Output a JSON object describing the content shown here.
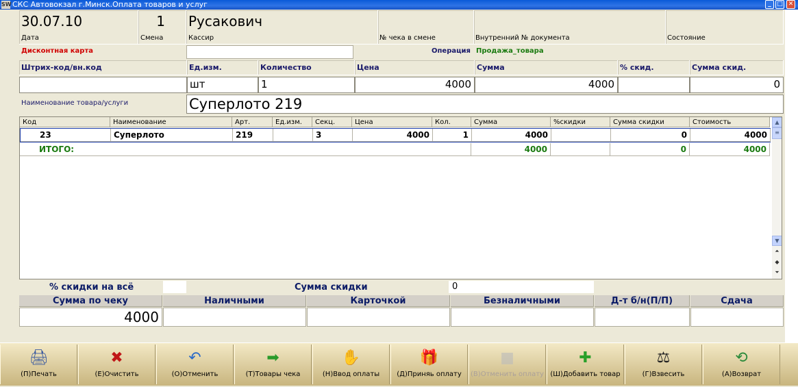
{
  "window": {
    "title": "СКС Автовокзал г.Минск.Оплата товаров и услуг",
    "icon_text": "SW"
  },
  "header": {
    "date_value": "30.07.10",
    "date_label": "Дата",
    "shift_value": "1",
    "shift_label": "Смена",
    "cashier_value": "Русакович",
    "cashier_label": "Кассир",
    "check_no_label": "№ чека в смене",
    "internal_doc_label": "Внутренний № документа",
    "state_label": "Состояние"
  },
  "discount": {
    "label": "Дисконтная карта",
    "value": ""
  },
  "operation": {
    "label": "Операция",
    "value": "Продажа_товара",
    "label_color": "#1a1a6a",
    "value_color": "#1a7a10"
  },
  "entry": {
    "barcode_label": "Штрих-код/вн.код",
    "barcode_value": "",
    "unit_label": "Ед.изм.",
    "unit_value": "шт",
    "qty_label": "Количество",
    "qty_value": "1",
    "price_label": "Цена",
    "price_value": "4000",
    "sum_label": "Сумма",
    "sum_value": "4000",
    "disc_pct_label": "% скид.",
    "disc_pct_value": "",
    "disc_sum_label": "Сумма скид.",
    "disc_sum_value": "0",
    "name_label": "Наименование товара/услуги",
    "name_value": "Суперлото 219"
  },
  "grid": {
    "columns": [
      "Код",
      "Наименование",
      "Арт.",
      "Ед.изм.",
      "Секц.",
      "Цена",
      "Кол.",
      "Сумма",
      "%скидки",
      "Сумма скидки",
      "Стоимость"
    ],
    "rows": [
      [
        "23",
        "Суперлото",
        "219",
        "",
        "3",
        "4000",
        "1",
        "4000",
        "",
        "0",
        "4000"
      ]
    ],
    "total": {
      "label": "ИТОГО:",
      "sum": "4000",
      "disc_sum": "0",
      "cost": "4000"
    }
  },
  "summary": {
    "discount_all_label": "% скидки на всё",
    "discount_all_value": "",
    "discount_sum_label": "Сумма скидки",
    "discount_sum_value": "0",
    "check_sum_label": "Сумма по чеку",
    "check_sum_value": "4000",
    "cash_label": "Наличными",
    "cash_value": "",
    "card_label": "Карточкой",
    "card_value": "",
    "noncash_label": "Безналичными",
    "noncash_value": "",
    "dt_label": "Д-т б/н(П/П)",
    "dt_value": "",
    "change_label": "Сдача",
    "change_value": ""
  },
  "toolbar": [
    {
      "label": "(П)Печать",
      "icon": "printer-icon",
      "glyph": "🖨",
      "enabled": true
    },
    {
      "label": "(Е)Очистить",
      "icon": "clear-doc-icon",
      "glyph": "✖",
      "enabled": true
    },
    {
      "label": "(О)Отменить",
      "icon": "undo-arrow-icon",
      "glyph": "↶",
      "enabled": true
    },
    {
      "label": "(Т)Товары чека",
      "icon": "doc-arrow-icon",
      "glyph": "➡",
      "enabled": true
    },
    {
      "label": "(Н)Ввод оплаты",
      "icon": "payment-hand-icon",
      "glyph": "✋",
      "enabled": true
    },
    {
      "label": "(Д)Приняь оплату",
      "icon": "gift-box-icon",
      "glyph": "🎁",
      "enabled": true
    },
    {
      "label": "(В)Отменить оплату",
      "icon": "cancel-payment-icon",
      "glyph": "■",
      "enabled": false
    },
    {
      "label": "(Ш)Добавить товар",
      "icon": "add-item-icon",
      "glyph": "✚",
      "enabled": true
    },
    {
      "label": "(Г)Взвесить",
      "icon": "weight-icon",
      "glyph": "⚖",
      "enabled": true
    },
    {
      "label": "(А)Возврат",
      "icon": "return-icon",
      "glyph": "⟲",
      "enabled": true
    }
  ]
}
